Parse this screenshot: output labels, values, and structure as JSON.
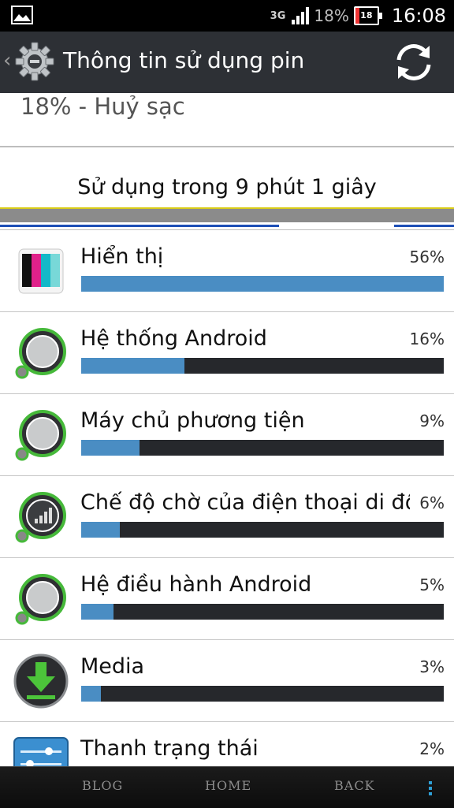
{
  "status_bar": {
    "network": "3G",
    "battery_percent": "18%",
    "battery_level": 18,
    "battery_icon_text": "18",
    "time": "16:08",
    "image_icon": "image-icon",
    "signal_icon": "signal-bars-icon"
  },
  "action_bar": {
    "title": "Thông tin sử dụng pin",
    "back_icon": "back-chevron-icon",
    "app_icon": "settings-gear-icon",
    "refresh_icon": "refresh-icon"
  },
  "summary": {
    "charge_status": "18% - Huỷ sạc",
    "usage_duration": "Sử dụng trong 9 phút 1 giây"
  },
  "apps": [
    {
      "name": "Hiển thị",
      "percent": "56%",
      "level": 56,
      "icon": "display-icon"
    },
    {
      "name": "Hệ thống Android",
      "percent": "16%",
      "level": 16,
      "icon": "android-system-icon"
    },
    {
      "name": "Máy chủ phương tiện",
      "percent": "9%",
      "level": 9,
      "icon": "media-server-icon"
    },
    {
      "name": "Chế độ chờ của điện thoại di động",
      "percent": "6%",
      "level": 6,
      "icon": "cell-standby-icon"
    },
    {
      "name": "Hệ điều hành Android",
      "percent": "5%",
      "level": 5,
      "icon": "android-os-icon"
    },
    {
      "name": "Media",
      "percent": "3%",
      "level": 3,
      "icon": "download-icon"
    },
    {
      "name": "Thanh trạng thái",
      "percent": "2%",
      "level": 2,
      "icon": "status-bar-icon"
    }
  ],
  "nav": {
    "blog": "BLOG",
    "home": "HOME",
    "back": "BACK",
    "menu_icon": "menu-dots-icon"
  },
  "colors": {
    "bar_fill": "#4a8dc3",
    "bar_track": "#26282c",
    "action_bar": "#2d3035",
    "accent_line": "#1d4fb6"
  }
}
